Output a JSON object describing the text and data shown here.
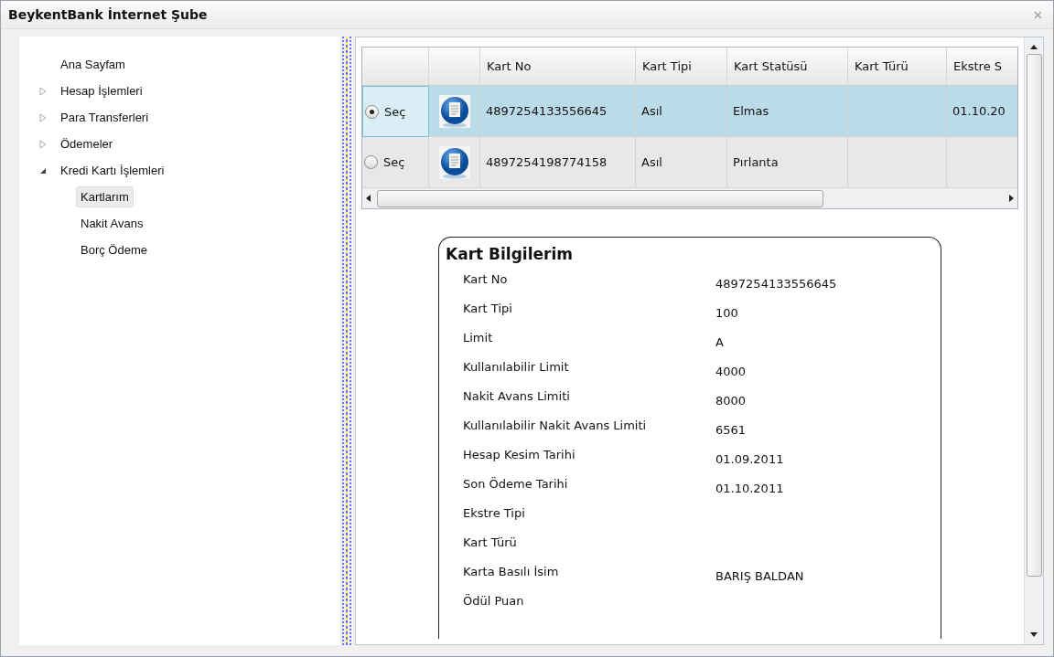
{
  "window": {
    "title": "BeykentBank İnternet Şube"
  },
  "tree": [
    {
      "label": "Ana Sayfam",
      "kind": "leaf",
      "selected": false
    },
    {
      "label": "Hesap İşlemleri",
      "kind": "group",
      "expanded": false,
      "selected": false
    },
    {
      "label": "Para Transferleri",
      "kind": "group",
      "expanded": false,
      "selected": false
    },
    {
      "label": "Ödemeler",
      "kind": "group",
      "expanded": false,
      "selected": false
    },
    {
      "label": "Kredi Kartı İşlemleri",
      "kind": "group",
      "expanded": true,
      "selected": false,
      "children": [
        {
          "label": "Kartlarım",
          "selected": true
        },
        {
          "label": "Nakit Avans",
          "selected": false
        },
        {
          "label": "Borç Ödeme",
          "selected": false
        }
      ]
    }
  ],
  "table": {
    "columns": [
      "Kart No",
      "Kart Tipi",
      "Kart Statüsü",
      "Kart Türü",
      "Ekstre S"
    ],
    "rows": [
      {
        "selected": true,
        "radio_label": "Seç",
        "cells": [
          "4897254133556645",
          "Asıl",
          "Elmas",
          "",
          "01.10.20"
        ]
      },
      {
        "selected": false,
        "radio_label": "Seç",
        "cells": [
          "4897254198774158",
          "Asıl",
          "Pırlanta",
          "",
          ""
        ]
      }
    ]
  },
  "card_info": {
    "title": "Kart Bilgilerim",
    "fields": [
      {
        "label": "Kart No",
        "value": "4897254133556645"
      },
      {
        "label": "Kart Tipi",
        "value": "100"
      },
      {
        "label": "Limit",
        "value": "A"
      },
      {
        "label": "Kullanılabilir Limit",
        "value": "4000"
      },
      {
        "label": "Nakit Avans Limiti",
        "value": "8000"
      },
      {
        "label": "Kullanılabilir Nakit Avans Limiti",
        "value": "6561"
      },
      {
        "label": "Hesap Kesim Tarihi",
        "value": "01.09.2011"
      },
      {
        "label": "Son Ödeme Tarihi",
        "value": "01.10.2011"
      },
      {
        "label": "Ekstre Tipi"
      },
      {
        "label": "Kart Türü"
      },
      {
        "label": "Karta Basılı İsim",
        "value": "BARIŞ BALDAN"
      },
      {
        "label": "Ödül Puan"
      }
    ]
  }
}
